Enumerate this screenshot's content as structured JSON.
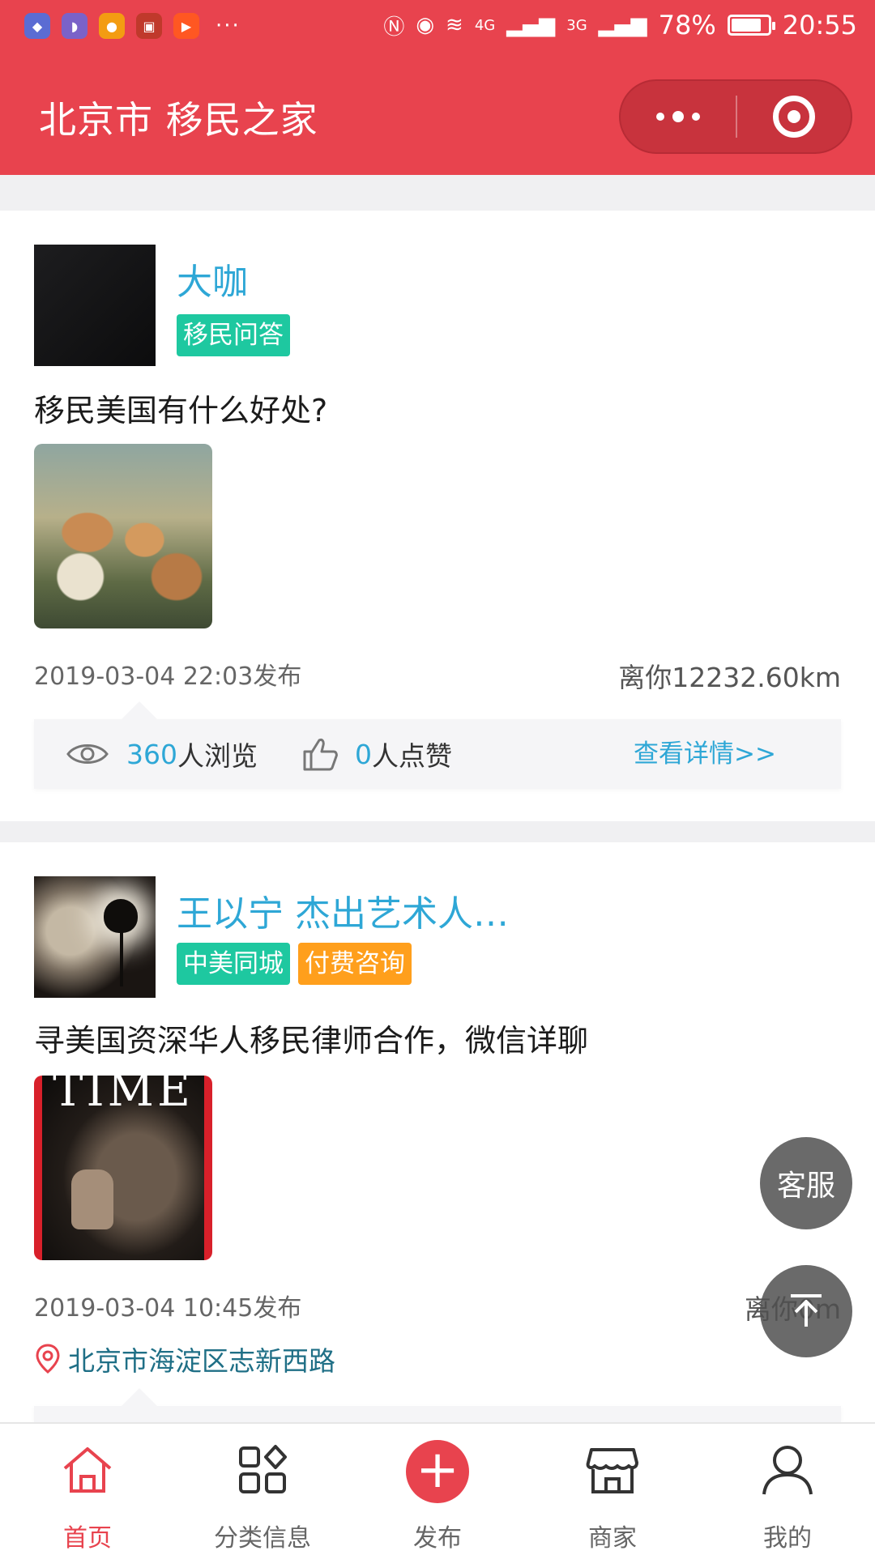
{
  "status_bar": {
    "battery": "78%",
    "time": "20:55",
    "net_4g": "4G",
    "net_3g": "3G"
  },
  "header": {
    "title": "北京市 移民之家"
  },
  "posts": [
    {
      "username": "大咖",
      "tags": [
        "移民问答"
      ],
      "title": "移民美国有什么好处?",
      "published": "2019-03-04 22:03发布",
      "distance": "离你12232.60km",
      "views": "360",
      "views_suffix": "人浏览",
      "likes": "0",
      "likes_suffix": " 人点赞",
      "detail_link": "查看详情>>"
    },
    {
      "username": "王以宁 杰出艺术人…",
      "tags": [
        "中美同城",
        "付费咨询"
      ],
      "title": "寻美国资深华人移民律师合作，微信详聊",
      "published": "2019-03-04 10:45发布",
      "distance": "离你0m",
      "location": "北京市海淀区志新西路",
      "thumbnail_logo": "TIME"
    }
  ],
  "floating": {
    "service_label": "客服",
    "top_icon": "arrow-up-to-top-icon"
  },
  "tabbar": {
    "items": [
      {
        "label": "首页",
        "icon": "home-icon",
        "active": true
      },
      {
        "label": "分类信息",
        "icon": "category-icon",
        "active": false
      },
      {
        "label": "发布",
        "icon": "plus-icon",
        "active": false
      },
      {
        "label": "商家",
        "icon": "shop-icon",
        "active": false
      },
      {
        "label": "我的",
        "icon": "user-icon",
        "active": false
      }
    ]
  },
  "colors": {
    "brand": "#e8434e",
    "link": "#2ea7d6",
    "tag_green": "#1ec8a0",
    "tag_orange": "#ff9f1c"
  }
}
